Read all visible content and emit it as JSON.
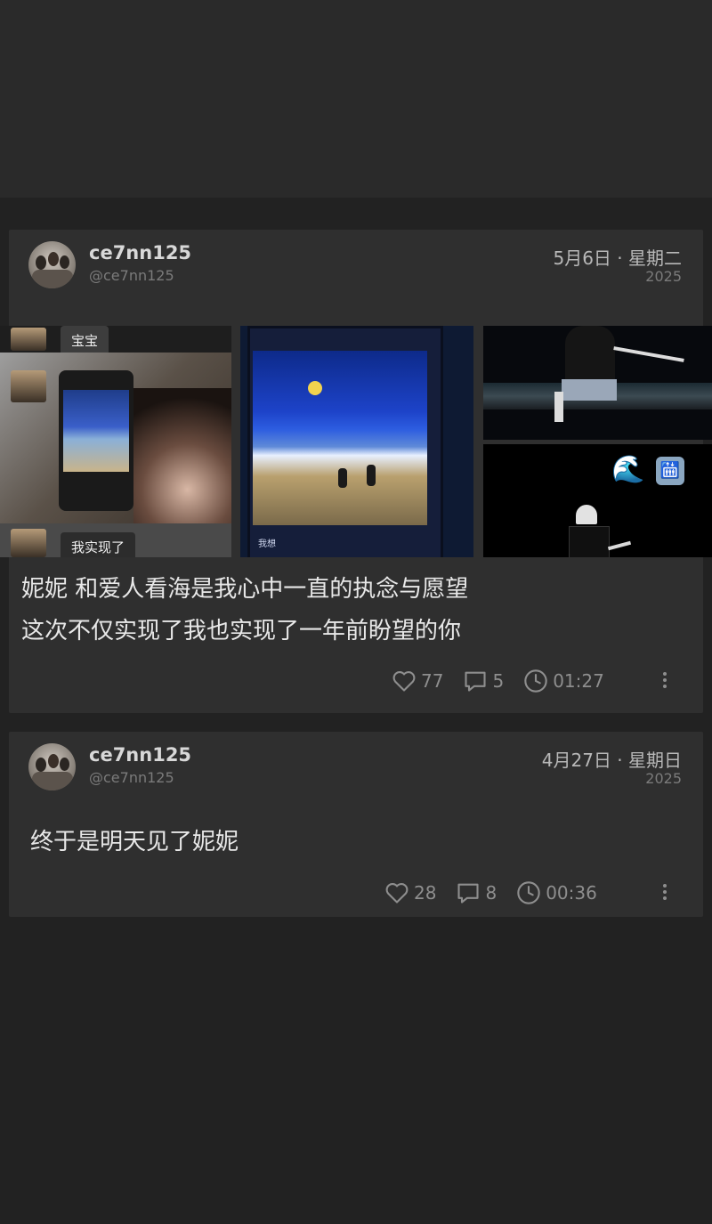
{
  "posts": [
    {
      "username": "ce7nn125",
      "handle": "@ce7nn125",
      "date": "5月6日 · 星期二",
      "year": "2025",
      "text_lines": [
        "妮妮 和爱人看海是我心中一直的执念与愿望",
        "这次不仅实现了我也实现了一年前盼望的你"
      ],
      "images": {
        "chat_top_label": "宝宝",
        "chat_bottom_label": "我实现了",
        "screen_caption": "我想",
        "emoji_wave": "🌊",
        "emoji_icon": "🛗"
      },
      "likes": "77",
      "comments": "5",
      "duration": "01:27"
    },
    {
      "username": "ce7nn125",
      "handle": "@ce7nn125",
      "date": "4月27日 · 星期日",
      "year": "2025",
      "text_lines": [
        "终于是明天见了妮妮"
      ],
      "likes": "28",
      "comments": "8",
      "duration": "00:36"
    }
  ],
  "icons": {
    "like": "heart-icon",
    "comment": "comment-icon",
    "duration": "clock-icon",
    "more": "more-vertical-icon"
  }
}
